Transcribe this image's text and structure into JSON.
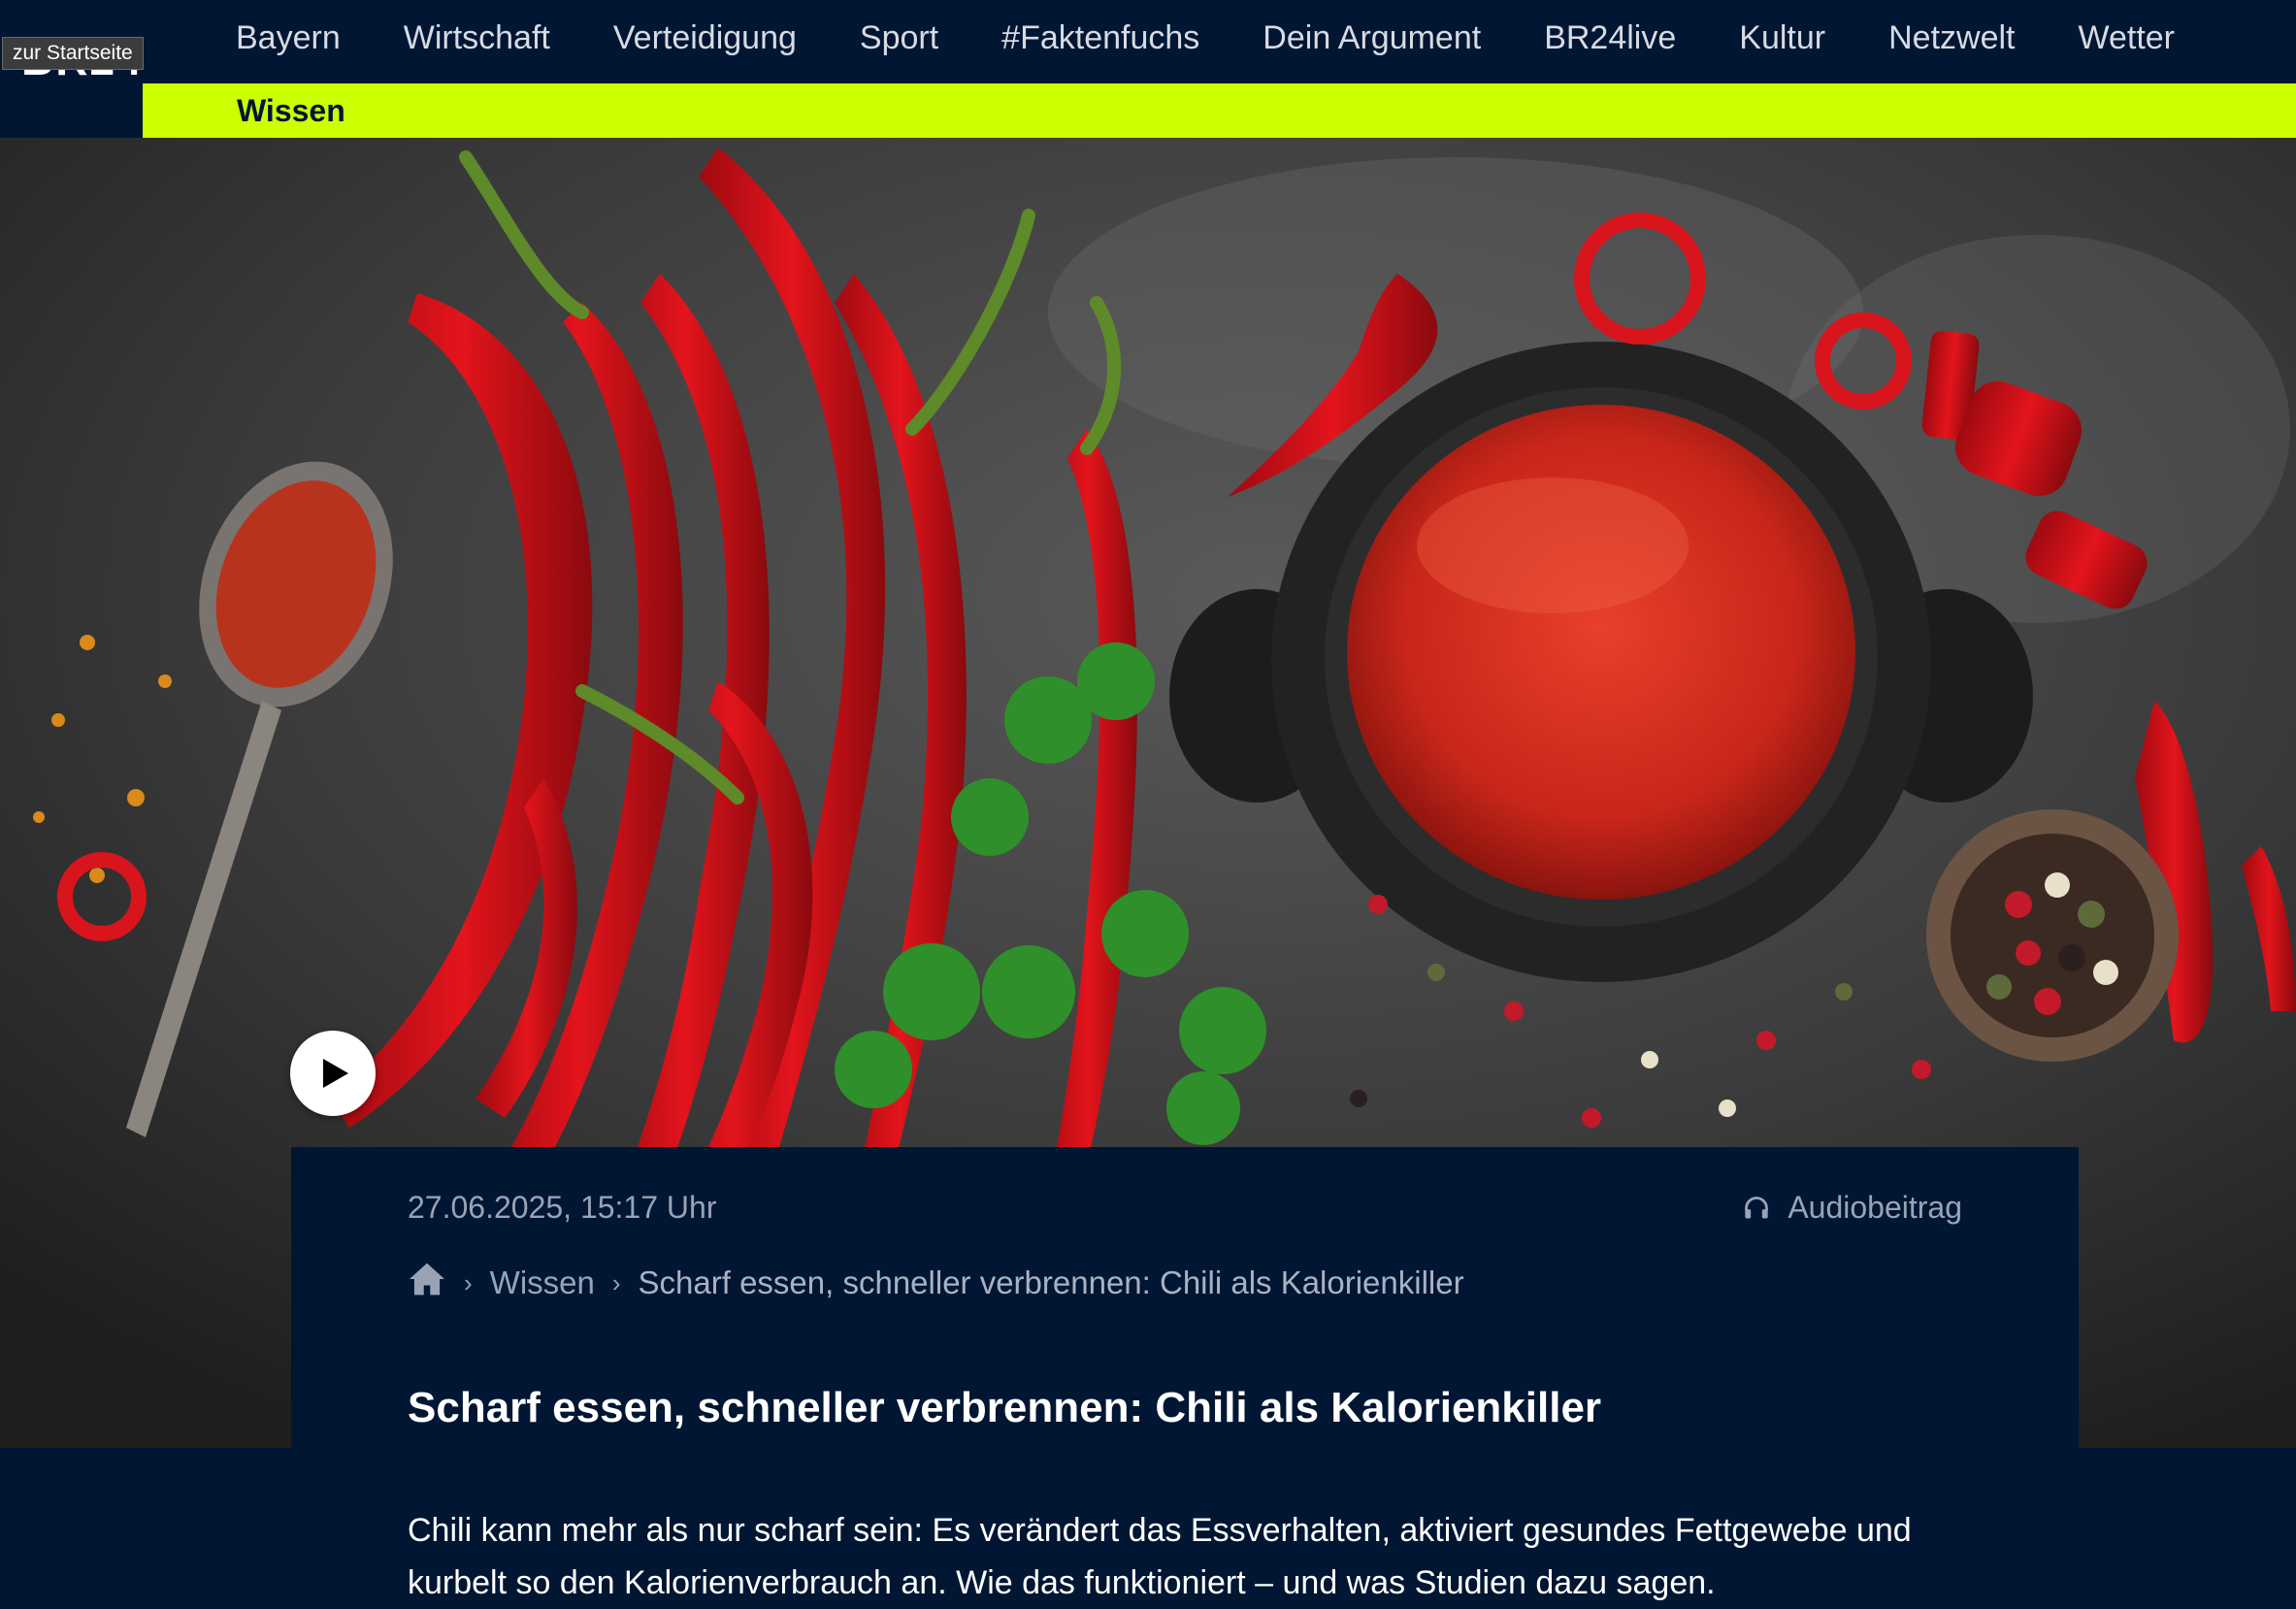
{
  "nav": {
    "skip_link": "zur Startseite",
    "logo": "BR24",
    "items": [
      "Bayern",
      "Wirtschaft",
      "Verteidigung",
      "Sport",
      "#Faktenfuchs",
      "Dein Argument",
      "BR24live",
      "Kultur",
      "Netzwelt",
      "Wetter"
    ]
  },
  "subnav": {
    "active": "Wissen",
    "accent_color": "#ccff00"
  },
  "hero": {
    "play_icon": "play-icon"
  },
  "article": {
    "date": "27.06.2025, 15:17 Uhr",
    "audio_label": "Audiobeitrag",
    "breadcrumb": {
      "home_icon": "home-icon",
      "section": "Wissen",
      "current": "Scharf essen, schneller verbrennen: Chili als Kalorienkiller"
    },
    "headline": "Scharf essen, schneller verbrennen: Chili als Kalorienkiller",
    "teaser": "Chili kann mehr als nur scharf sein: Es verändert das Essverhalten, aktiviert gesundes Fettgewebe und kurbelt so den Kalorienverbrauch an. Wie das funktioniert – und was Studien dazu sagen."
  },
  "colors": {
    "navy": "#001633",
    "accent": "#ccff00",
    "muted_text": "#9aa3b5"
  }
}
